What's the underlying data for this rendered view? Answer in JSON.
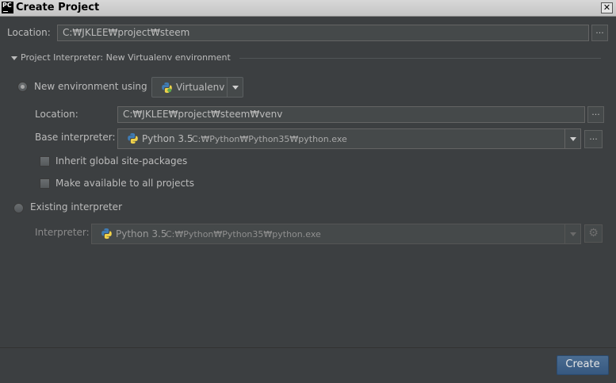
{
  "window": {
    "app_icon_text": "PC",
    "title": "Create Project",
    "close_glyph": "✕"
  },
  "location": {
    "label": "Location:",
    "value": "C:₩JKLEE₩project₩steem",
    "browse": "..."
  },
  "interpreter_section": {
    "title": "Project Interpreter: New Virtualenv environment"
  },
  "new_env": {
    "label": "New environment using",
    "selected": true,
    "tool": "Virtualenv",
    "location_label": "Location:",
    "location_value": "C:₩JKLEE₩project₩steem₩venv",
    "base_label": "Base interpreter:",
    "base_name": "Python 3.5",
    "base_path": "C:₩Python₩Python35₩python.exe",
    "inherit_label": "Inherit global site-packages",
    "make_available_label": "Make available to all projects"
  },
  "existing": {
    "label": "Existing interpreter",
    "selected": false,
    "interpreter_label": "Interpreter:",
    "interpreter_name": "Python 3.5",
    "interpreter_path": "C:₩Python₩Python35₩python.exe"
  },
  "footer": {
    "create_label": "Create"
  },
  "colors": {
    "background": "#3c3f41",
    "field": "#45494a",
    "accent_button": "#365880",
    "text": "#bbbbbb"
  }
}
